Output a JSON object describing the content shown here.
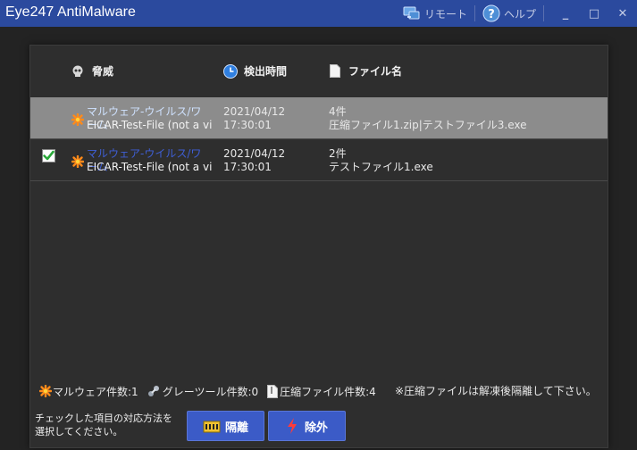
{
  "window": {
    "title": "Eye247 AntiMalware",
    "remote_label": "リモート",
    "help_label": "ヘルプ",
    "minimize": "_",
    "maximize": "□",
    "close": "✕"
  },
  "table": {
    "headers": {
      "threat": "脅威",
      "detected_time": "検出時間",
      "filename": "ファイル名"
    },
    "rows": [
      {
        "threat_name": "マルウェア-ウイルス/ワーム",
        "threat_detail": "EICAR-Test-File (not a virus)",
        "date": "2021/04/12",
        "time": "17:30:01",
        "count": "4件",
        "files": "圧縮ファイル1.zip|テストファイル3.exe",
        "checked": false,
        "selected": true
      },
      {
        "threat_name": "マルウェア-ウイルス/ワーム",
        "threat_detail": "EICAR-Test-File (not a virus)",
        "date": "2021/04/12",
        "time": "17:30:01",
        "count": "2件",
        "files": "テストファイル1.exe",
        "checked": true,
        "selected": false
      }
    ]
  },
  "stats": {
    "malware": "マルウェア件数:1",
    "greyware": "グレーツール件数:0",
    "compressed": "圧縮ファイル件数:4",
    "note": "※圧縮ファイルは解凍後隔離して下さい。"
  },
  "footer": {
    "instruction_line1": "チェックした項目の対応方法を",
    "instruction_line2": "選択してください。",
    "quarantine_label": "隔離",
    "exclude_label": "除外"
  },
  "colors": {
    "titlebar": "#2b4a9e",
    "selected_row": "#8c8c8c",
    "button": "#3b5bc7",
    "threat_link": "#7fb0ff"
  }
}
